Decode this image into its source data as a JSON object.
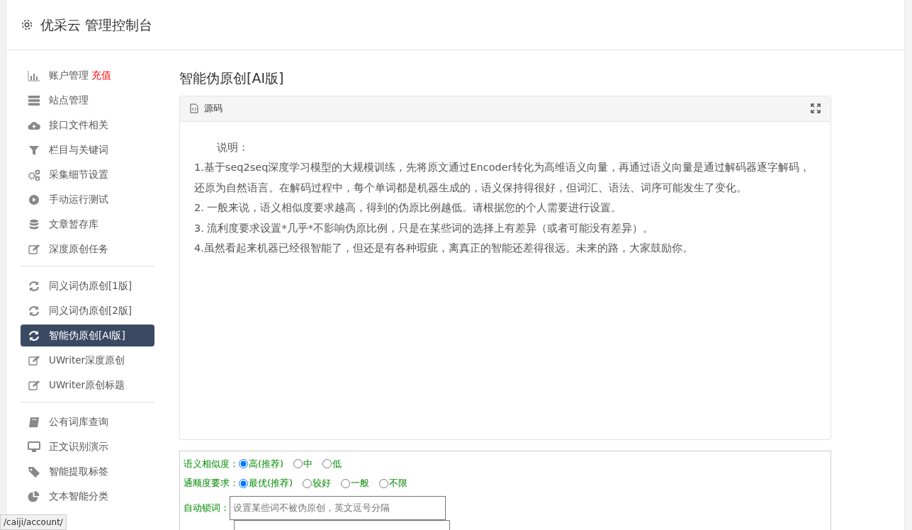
{
  "header": {
    "title": "优采云 管理控制台"
  },
  "sidebar": {
    "groups": [
      {
        "items": [
          {
            "label": "账户管理",
            "badge": "充值",
            "selected": false
          },
          {
            "label": "站点管理",
            "selected": false
          },
          {
            "label": "接口文件相关",
            "selected": false
          },
          {
            "label": "栏目与关键词",
            "selected": false
          },
          {
            "label": "采集细节设置",
            "selected": false
          },
          {
            "label": "手动运行测试",
            "selected": false
          },
          {
            "label": "文章暂存库",
            "selected": false
          },
          {
            "label": "深度原创任务",
            "selected": false
          }
        ]
      },
      {
        "items": [
          {
            "label": "同义词伪原创[1版]",
            "selected": false
          },
          {
            "label": "同义词伪原创[2版]",
            "selected": false
          },
          {
            "label": "智能伪原创[AI版]",
            "selected": true
          },
          {
            "label": "UWriter深度原创",
            "selected": false
          },
          {
            "label": "UWriter原创标题",
            "selected": false
          }
        ]
      },
      {
        "items": [
          {
            "label": "公有词库查询",
            "selected": false
          },
          {
            "label": "正文识别演示",
            "selected": false
          },
          {
            "label": "智能提取标签",
            "selected": false
          },
          {
            "label": "文本智能分类",
            "selected": false
          }
        ]
      }
    ]
  },
  "page_title": "智能伪原创[AI版]",
  "editor": {
    "toolbar_label": "源码",
    "lines": [
      "说明：",
      "1.基于seq2seq深度学习模型的大规模训练，先将原文通过Encoder转化为高维语义向量，再通过语义向量是通过解码器逐字解码，还原为自然语言。在解码过程中，每个单词都是机器生成的，语义保持得很好，但词汇、语法、词序可能发生了变化。",
      "2. 一般来说，语义相似度要求越高，得到的伪原比例越低。请根据您的个人需要进行设置。",
      "3. 流利度要求设置*几乎*不影响伪原比例，只是在某些词的选择上有差异（或者可能没有差异）。",
      "4.虽然看起来机器已经很智能了，但还是有各种瑕疵，离真正的智能还差得很远。未来的路，大家鼓励你。"
    ]
  },
  "options": [
    {
      "label": "语义相似度：",
      "choices": [
        {
          "label": "高(推荐)",
          "selected": true
        },
        {
          "label": "中",
          "selected": false
        },
        {
          "label": "低",
          "selected": false
        }
      ]
    },
    {
      "label": "通顺度要求：",
      "choices": [
        {
          "label": "最优(推荐)",
          "selected": true
        },
        {
          "label": "较好",
          "selected": false
        },
        {
          "label": "一般",
          "selected": false
        },
        {
          "label": "不限",
          "selected": false
        }
      ]
    }
  ],
  "lock_words": {
    "label": "自动锁词：",
    "placeholder": "设置某些词不被伪原创，英文逗号分隔"
  },
  "status_bar": {
    "url": "/caiji/account/"
  }
}
